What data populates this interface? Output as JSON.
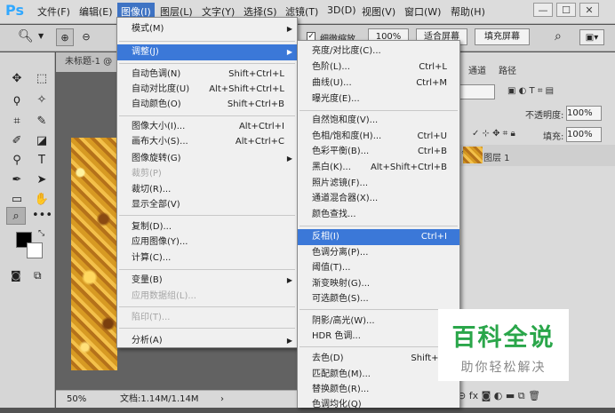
{
  "app": {
    "logo": "Ps"
  },
  "menubar": [
    "文件(F)",
    "编辑(E)",
    "图像(I)",
    "图层(L)",
    "文字(Y)",
    "选择(S)",
    "滤镜(T)",
    "3D(D)",
    "视图(V)",
    "窗口(W)",
    "帮助(H)"
  ],
  "window_controls": {
    "minimize": "—",
    "maximize": "☐",
    "close": "✕"
  },
  "options_bar": {
    "checkbox_label": "细微缩放",
    "zoom_value": "100%",
    "fit_screen": "适合屏幕",
    "fill_screen": "填充屏幕"
  },
  "document": {
    "tab_title": "未标题-1 @",
    "zoom": "50%",
    "doc_info": "文档:1.14M/1.14M"
  },
  "right_panel": {
    "tabs": [
      "通道",
      "路径"
    ],
    "opacity_label": "不透明度:",
    "opacity_value": "100%",
    "fill_label": "填充:",
    "fill_value": "100%",
    "layer_name": "图层 1"
  },
  "image_menu": [
    {
      "label": "模式(M)",
      "submenu": true
    },
    {
      "label": "调整(J)",
      "submenu": true,
      "highlight": true
    },
    {
      "label": "自动色调(N)",
      "shortcut": "Shift+Ctrl+L"
    },
    {
      "label": "自动对比度(U)",
      "shortcut": "Alt+Shift+Ctrl+L"
    },
    {
      "label": "自动颜色(O)",
      "shortcut": "Shift+Ctrl+B"
    },
    {
      "label": "图像大小(I)...",
      "shortcut": "Alt+Ctrl+I"
    },
    {
      "label": "画布大小(S)...",
      "shortcut": "Alt+Ctrl+C"
    },
    {
      "label": "图像旋转(G)",
      "submenu": true
    },
    {
      "label": "裁剪(P)",
      "disabled": true
    },
    {
      "label": "裁切(R)..."
    },
    {
      "label": "显示全部(V)"
    },
    {
      "label": "复制(D)..."
    },
    {
      "label": "应用图像(Y)..."
    },
    {
      "label": "计算(C)..."
    },
    {
      "label": "变量(B)",
      "submenu": true
    },
    {
      "label": "应用数据组(L)...",
      "disabled": true
    },
    {
      "label": "陷印(T)...",
      "disabled": true
    },
    {
      "label": "分析(A)",
      "submenu": true
    }
  ],
  "adjust_menu": [
    {
      "label": "亮度/对比度(C)..."
    },
    {
      "label": "色阶(L)...",
      "shortcut": "Ctrl+L"
    },
    {
      "label": "曲线(U)...",
      "shortcut": "Ctrl+M"
    },
    {
      "label": "曝光度(E)..."
    },
    {
      "label": "自然饱和度(V)..."
    },
    {
      "label": "色相/饱和度(H)...",
      "shortcut": "Ctrl+U"
    },
    {
      "label": "色彩平衡(B)...",
      "shortcut": "Ctrl+B"
    },
    {
      "label": "黑白(K)...",
      "shortcut": "Alt+Shift+Ctrl+B"
    },
    {
      "label": "照片滤镜(F)..."
    },
    {
      "label": "通道混合器(X)..."
    },
    {
      "label": "颜色查找..."
    },
    {
      "label": "反相(I)",
      "shortcut": "Ctrl+I",
      "highlight": true
    },
    {
      "label": "色调分离(P)..."
    },
    {
      "label": "阈值(T)..."
    },
    {
      "label": "渐变映射(G)..."
    },
    {
      "label": "可选颜色(S)..."
    },
    {
      "label": "阴影/高光(W)..."
    },
    {
      "label": "HDR 色调..."
    },
    {
      "label": "去色(D)",
      "shortcut": "Shift+Ctrl+U"
    },
    {
      "label": "匹配颜色(M)..."
    },
    {
      "label": "替换颜色(R)..."
    },
    {
      "label": "色调均化(Q)"
    }
  ],
  "watermark": {
    "title": "百科全说",
    "subtitle": "助你轻松解决"
  },
  "colors": {
    "menu_highlight": "#3b78d8",
    "watermark_green": "#2aa64a"
  }
}
